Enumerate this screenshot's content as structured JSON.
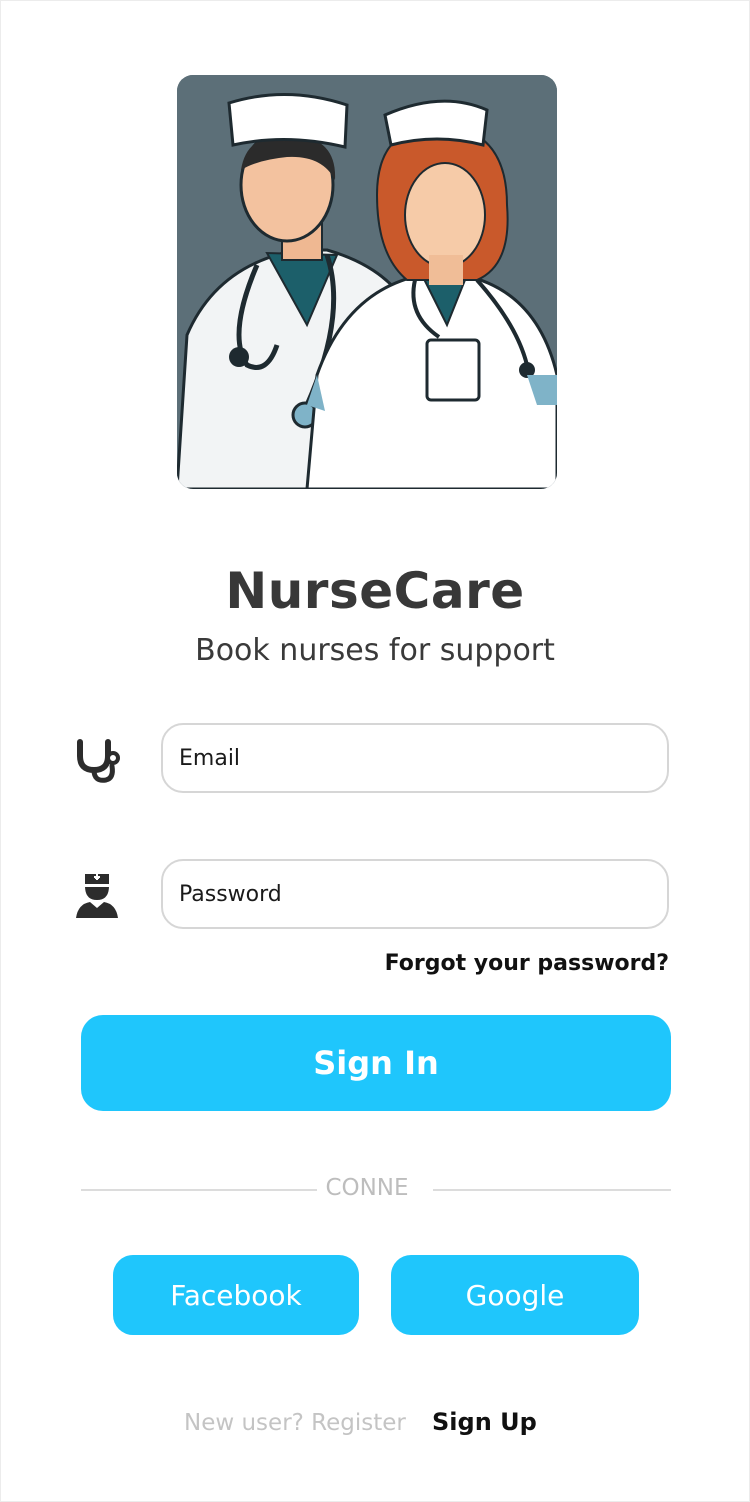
{
  "app": {
    "title": "NurseCare",
    "subtitle": "Book nurses for support"
  },
  "form": {
    "email_placeholder": "Email",
    "password_placeholder": "Password",
    "forgot_label": "Forgot your password?",
    "signin_label": "Sign In"
  },
  "divider": {
    "label": "CONNE"
  },
  "social": {
    "facebook_label": "Facebook",
    "google_label": "Google"
  },
  "footer": {
    "prompt": "New user? Register",
    "signup_label": "Sign Up"
  },
  "colors": {
    "accent": "#1fc6fc",
    "title_text": "#383838",
    "muted_text": "#c4c4c4",
    "hero_background": "#5c6f78"
  },
  "icons": {
    "email_field_icon": "stethoscope-icon",
    "password_field_icon": "nurse-avatar-icon"
  }
}
